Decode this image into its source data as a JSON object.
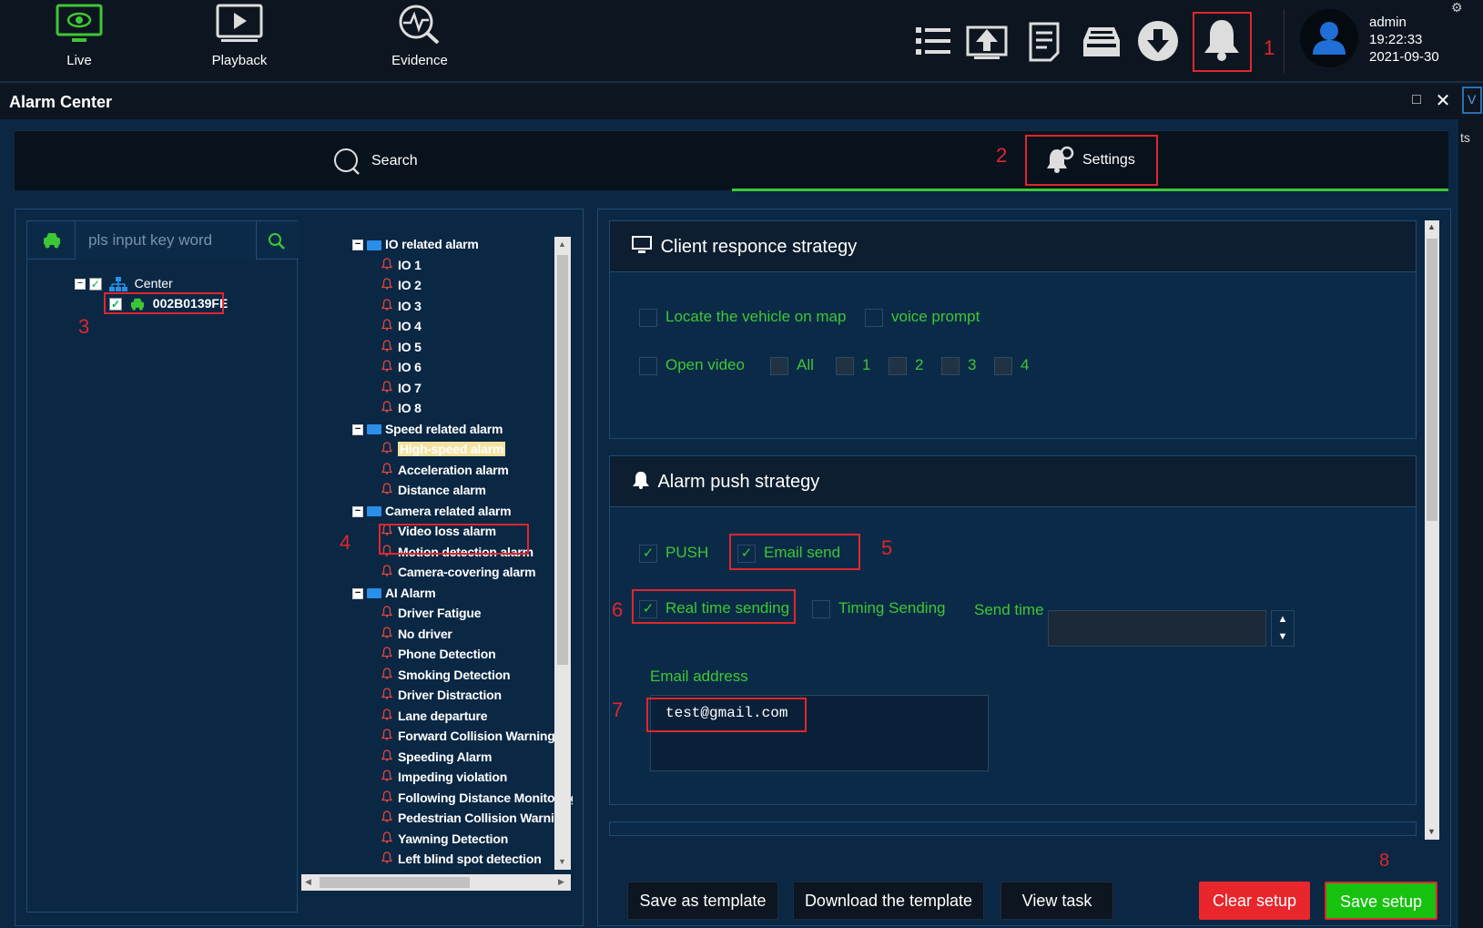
{
  "nav": {
    "live": "Live",
    "playback": "Playback",
    "evidence": "Evidence"
  },
  "toolbar_icons": [
    "list-icon",
    "upload-icon",
    "report-icon",
    "inbox-icon",
    "download-icon",
    "bell-icon"
  ],
  "user": {
    "name": "admin",
    "time": "19:22:33",
    "date": "2021-09-30"
  },
  "annotations": {
    "n1": "1",
    "n2": "2",
    "n3": "3",
    "n4": "4",
    "n5": "5",
    "n6": "6",
    "n7": "7",
    "n8": "8"
  },
  "window": {
    "title": "Alarm Center",
    "maximize": "□",
    "close": "✕",
    "side_label": "ts",
    "side_tab": "V"
  },
  "tabs": {
    "search": "Search",
    "settings": "Settings"
  },
  "device_tree": {
    "search_placeholder": "pls input key word",
    "root": "Center",
    "device": "002B0139FE"
  },
  "alarm_tree": {
    "groups": [
      {
        "name": "IO related alarm",
        "items": [
          "IO 1",
          "IO 2",
          "IO 3",
          "IO 4",
          "IO 5",
          "IO 6",
          "IO 7",
          "IO 8"
        ]
      },
      {
        "name": "Speed related alarm",
        "items": [
          "High-speed alarm",
          "Acceleration alarm",
          "Distance alarm"
        ]
      },
      {
        "name": "Camera related alarm",
        "items": [
          "Video loss alarm",
          "Motion detection alarm",
          "Camera-covering alarm"
        ]
      },
      {
        "name": "AI Alarm",
        "items": [
          "Driver Fatigue",
          "No driver",
          "Phone Detection",
          "Smoking Detection",
          "Driver Distraction",
          "Lane departure",
          "Forward Collision Warning",
          "Speeding Alarm",
          "Impeding violation",
          "Following Distance Monitoring",
          "Pedestrian Collision Warning",
          "Yawning Detection",
          "Left blind spot detection"
        ]
      }
    ],
    "selected": "High-speed alarm"
  },
  "client_strategy": {
    "title": "Client responce strategy",
    "locate": "Locate the vehicle on map",
    "voice": "voice prompt",
    "open_video": "Open video",
    "all": "All",
    "ch1": "1",
    "ch2": "2",
    "ch3": "3",
    "ch4": "4"
  },
  "push_strategy": {
    "title": "Alarm push strategy",
    "push": "PUSH",
    "email_send": "Email send",
    "realtime": "Real time sending",
    "timing": "Timing Sending",
    "send_time": "Send time",
    "email_label": "Email address",
    "email_value": "test@gmail.com"
  },
  "buttons": {
    "save_template": "Save as template",
    "download_template": "Download the template",
    "view_task": "View task",
    "clear": "Clear setup",
    "save": "Save setup"
  },
  "colors": {
    "accent_green": "#3ec734",
    "annotation_red": "#e0262c",
    "panel_bg": "#0b2744"
  }
}
